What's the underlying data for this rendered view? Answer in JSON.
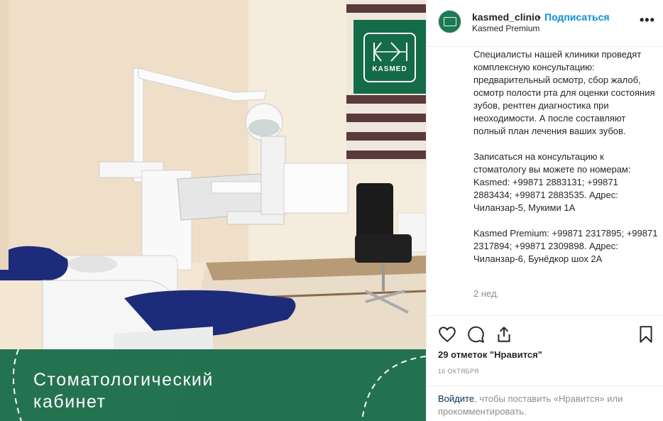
{
  "post": {
    "image": {
      "logo_text": "KASMED",
      "caption_line1": "Стоматологический",
      "caption_line2": "кабинет"
    },
    "header": {
      "username": "kasmed_clinic",
      "separator": "•",
      "follow_label": "Подписаться",
      "location": "Kasmed Premium",
      "more_icon": "more-horizontal-icon"
    },
    "caption": {
      "paragraph1": "Специалисты нашей клиники проведят комплексную консультацию: предварительный осмотр, сбор жалоб, осмотр полости рта для оценки состояния зубов, рентген диагностика при неоходимости. А после составляют полный план лечения ваших зубов.",
      "paragraph2": "Записаться на консультацию к стоматологу вы можете по номерам: Kasmed: +99871 2883131; +99871 2883434; +99871 2883535. Адрес: Чиланзар-5, Мукими 1А",
      "paragraph3": "Kasmed Premium: +99871 2317895; +99871 2317894; +99871 2309898. Адрес: Чиланзар-6, Бунёдкор шох 2А",
      "time_ago": "2 нед."
    },
    "actions": {
      "like_icon": "heart-icon",
      "comment_icon": "comment-icon",
      "share_icon": "share-icon",
      "save_icon": "bookmark-icon",
      "likes_text": "29 отметок \"Нравится\"",
      "date": "16 ОКТЯБРЯ"
    },
    "login_prompt": {
      "link_text": "Войдите",
      "rest_text": ", чтобы поставить «Нравится» или прокомментировать."
    },
    "colors": {
      "brand_green": "#136b48",
      "follow_blue": "#0095f6",
      "chair_blue": "#1d2c7a"
    }
  }
}
